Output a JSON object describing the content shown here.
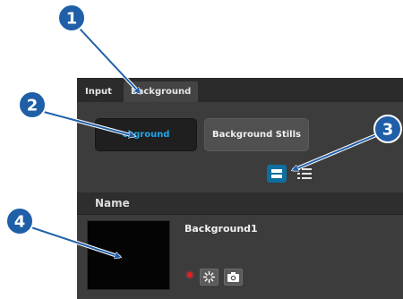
{
  "tabs": [
    {
      "label": "Input",
      "active": false
    },
    {
      "label": "Background",
      "active": true
    }
  ],
  "mode_buttons": {
    "background": "ckground",
    "stills": "Background Stills"
  },
  "view_toggle": {
    "grid_icon": "thumbnail-view-icon",
    "list_icon": "list-view-icon",
    "active": "grid"
  },
  "list": {
    "header": "Name",
    "items": [
      {
        "name": "Background1",
        "status_color": "#e02020"
      }
    ],
    "item_icons": [
      "select-icon",
      "camera-icon"
    ]
  },
  "callouts": [
    {
      "number": "1"
    },
    {
      "number": "2"
    },
    {
      "number": "3"
    },
    {
      "number": "4"
    }
  ],
  "colors": {
    "accent": "#1fa7e8",
    "callout": "#1f5fa8",
    "active_view_btn": "#0e6fa0"
  }
}
